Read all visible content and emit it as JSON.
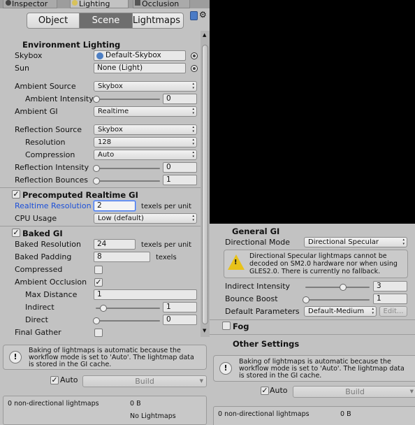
{
  "tabs": [
    "Inspector",
    "Lighting",
    "Occlusion"
  ],
  "modes": [
    "Object",
    "Scene",
    "Lightmaps"
  ],
  "env": {
    "title": "Environment Lighting",
    "skybox_label": "Skybox",
    "skybox_value": "Default-Skybox",
    "sun_label": "Sun",
    "sun_value": "None (Light)",
    "amb_source_label": "Ambient Source",
    "amb_source": "Skybox",
    "amb_intensity_label": "Ambient Intensity",
    "amb_intensity": "0",
    "amb_gi_label": "Ambient GI",
    "amb_gi": "Realtime",
    "ref_source_label": "Reflection Source",
    "ref_source": "Skybox",
    "resolution_label": "Resolution",
    "resolution": "128",
    "compression_label": "Compression",
    "compression": "Auto",
    "ref_intensity_label": "Reflection Intensity",
    "ref_intensity": "0",
    "ref_bounces_label": "Reflection Bounces",
    "ref_bounces": "1"
  },
  "realtime": {
    "title": "Precomputed Realtime GI",
    "res_label": "Realtime Resolution",
    "res": "2",
    "res_unit": "texels per unit",
    "cpu_label": "CPU Usage",
    "cpu": "Low (default)"
  },
  "baked": {
    "title": "Baked GI",
    "res_label": "Baked Resolution",
    "res": "24",
    "res_unit": "texels per unit",
    "pad_label": "Baked Padding",
    "pad": "8",
    "pad_unit": "texels",
    "compressed_label": "Compressed",
    "ao_label": "Ambient Occlusion",
    "max_dist_label": "Max Distance",
    "max_dist": "1",
    "indirect_label": "Indirect",
    "indirect": "1",
    "direct_label": "Direct",
    "direct": "0",
    "final_gather_label": "Final Gather"
  },
  "general": {
    "title": "General GI",
    "dir_mode_label": "Directional Mode",
    "dir_mode": "Directional Specular",
    "warning": [
      "Directional Specular lightmaps cannot be",
      "decoded on SM2.0 hardware nor when using",
      "GLES2.0. There is currently no fallback."
    ],
    "ind_intensity_label": "Indirect Intensity",
    "ind_intensity": "3",
    "bounce_label": "Bounce Boost",
    "bounce": "1",
    "default_params_label": "Default Parameters",
    "default_params": "Default-Medium",
    "edit_label": "Edit..."
  },
  "fog_label": "Fog",
  "other_settings": "Other Settings",
  "info_lines": [
    "Baking of lightmaps is automatic because the",
    "workflow mode is set to 'Auto'. The lightmap data",
    "is stored in the GI cache."
  ],
  "auto_label": "Auto",
  "build_label": "Build",
  "stats": {
    "lightmaps": "0 non-directional lightmaps",
    "size": "0 B",
    "no_lightmaps": "No Lightmaps"
  },
  "slider_levels": {
    "ambient_intensity": 0,
    "reflection_intensity": 0,
    "reflection_bounces": 0,
    "indirect": 0.2,
    "direct": 0,
    "indirect_intensity": 0.6,
    "bounce_boost": 0
  }
}
